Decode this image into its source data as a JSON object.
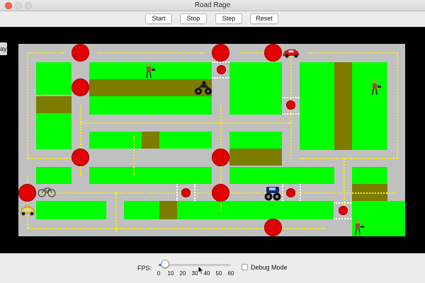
{
  "window": {
    "title": "Road Rage"
  },
  "toolbar": {
    "start_label": "Start",
    "stop_label": "Stop",
    "step_label": "Step",
    "reset_label": "Reset"
  },
  "side_tab": {
    "label": "ay"
  },
  "controls": {
    "fps_label": "FPS:",
    "fps_ticks": [
      "0",
      "10",
      "20",
      "30",
      "40",
      "50",
      "60"
    ],
    "fps_value": 5,
    "fps_min": 0,
    "fps_max": 60,
    "debug_label": "Debug Mode",
    "debug_checked": false
  },
  "map": {
    "colors": {
      "grass": "#00ff00",
      "dirt": "#7c7c00",
      "road": "#c0c0c0",
      "light_red": "#e00000",
      "lane_marker": "#ffee00",
      "crosswalk": "#ffffff",
      "background": "#000000"
    },
    "vehicles": [
      "taxi-icon",
      "sports-car-icon",
      "atv-icon",
      "monster-truck-icon",
      "bicycle-icon"
    ],
    "pedestrians": [
      "pedestrian-icon",
      "pedestrian-icon",
      "pedestrian-icon"
    ]
  }
}
